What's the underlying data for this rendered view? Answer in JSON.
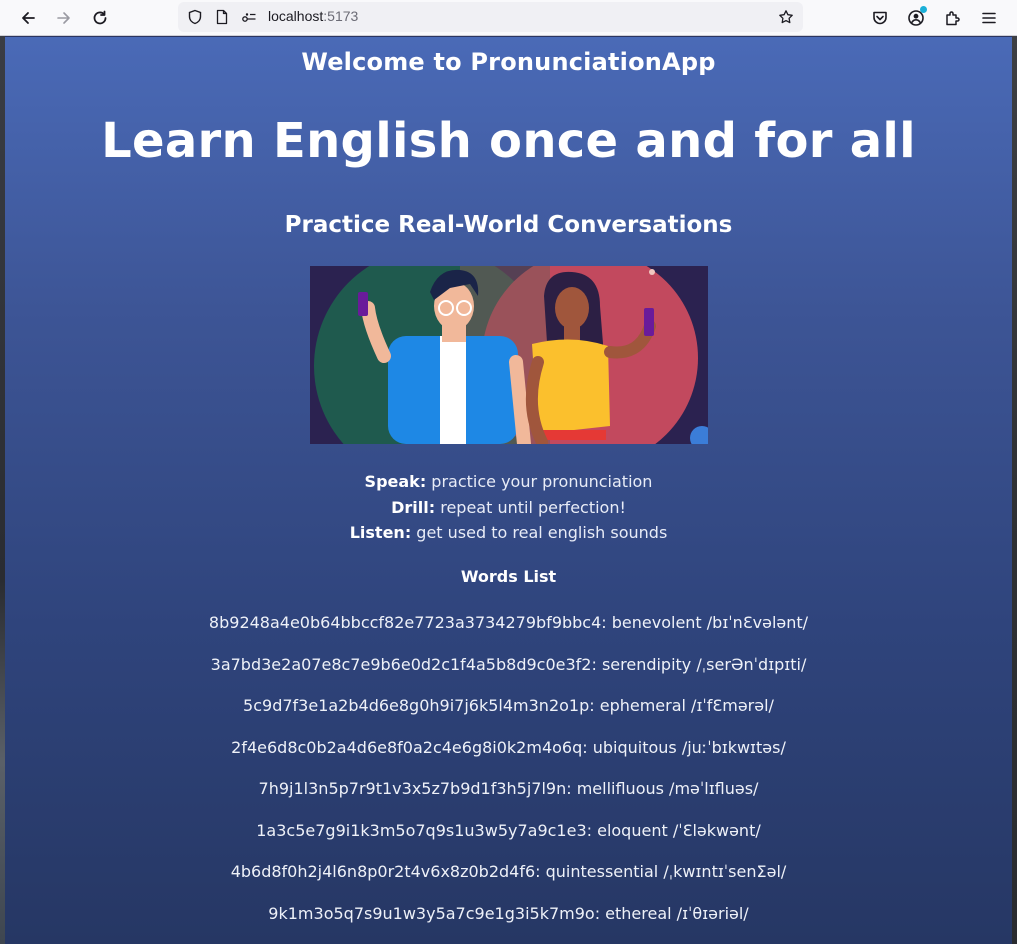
{
  "browser": {
    "url_host": "localhost",
    "url_port": ":5173"
  },
  "page": {
    "welcome": "Welcome to PronunciationApp",
    "hero": "Learn English once and for all",
    "subtitle": "Practice Real-World Conversations",
    "illustration_icon": "people-with-phones-illustration",
    "features": [
      {
        "label": "Speak:",
        "text": " practice your pronunciation"
      },
      {
        "label": "Drill:",
        "text": " repeat until perfection!"
      },
      {
        "label": "Listen:",
        "text": " get used to real english sounds"
      }
    ],
    "words_title": "Words List",
    "words": [
      "8b9248a4e0b64bbccf82e7723a3734279bf9bbc4: benevolent /bɪˈnƐvələnt/",
      "3a7bd3e2a07e8c7e9b6e0d2c1f4a5b8d9c0e3f2: serendipity /ˌserƏnˈdɪpɪti/",
      "5c9d7f3e1a2b4d6e8g0h9i7j6k5l4m3n2o1p: ephemeral /ɪˈfƐmərəl/",
      "2f4e6d8c0b2a4d6e8f0a2c4e6g8i0k2m4o6q: ubiquitous /juːˈbɪkwɪtəs/",
      "7h9j1l3n5p7r9t1v3x5z7b9d1f3h5j7l9n: mellifluous /məˈlɪfluəs/",
      "1a3c5e7g9i1k3m5o7q9s1u3w5y7a9c1e3: eloquent /ˈƐləkwənt/",
      "4b6d8f0h2j4l6n8p0r2t4v6x8z0b2d4f6: quintessential /ˌkwɪntɪˈsenƩəl/",
      "9k1m3o5q7s9u1w3y5a7c9e1g3i5k7m9o: ethereal /ɪˈθɪəriəl/"
    ]
  },
  "colors": {
    "page_gradient_top": "#4a6ab7",
    "page_gradient_bottom": "#263764",
    "toolbar": "#f9f9fb"
  }
}
